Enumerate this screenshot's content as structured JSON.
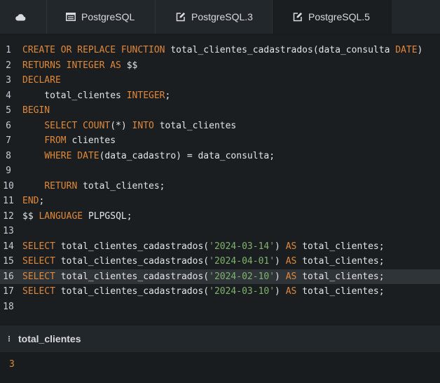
{
  "tabs": {
    "home_icon": "cloud-icon",
    "items": [
      {
        "label": "PostgreSQL",
        "icon": "table-icon",
        "active": false
      },
      {
        "label": "PostgreSQL.3",
        "icon": "edit-icon",
        "active": false
      },
      {
        "label": "PostgreSQL.5",
        "icon": "edit-icon",
        "active": true
      }
    ]
  },
  "editor": {
    "highlighted_line": 16,
    "lines": [
      [
        [
          "kw",
          "CREATE OR REPLACE FUNCTION "
        ],
        [
          "t",
          "total_clientes_cadastrados(data_consulta "
        ],
        [
          "kw",
          "DATE"
        ],
        [
          "t",
          ")"
        ]
      ],
      [
        [
          "kw",
          "RETURNS INTEGER AS "
        ],
        [
          "t",
          "$$"
        ]
      ],
      [
        [
          "kw",
          "DECLARE"
        ]
      ],
      [
        [
          "t",
          "    total_clientes "
        ],
        [
          "kw",
          "INTEGER"
        ],
        [
          "t",
          ";"
        ]
      ],
      [
        [
          "kw",
          "BEGIN"
        ]
      ],
      [
        [
          "t",
          "    "
        ],
        [
          "kw",
          "SELECT COUNT"
        ],
        [
          "t",
          "(*) "
        ],
        [
          "kw",
          "INTO "
        ],
        [
          "t",
          "total_clientes"
        ]
      ],
      [
        [
          "t",
          "    "
        ],
        [
          "kw",
          "FROM "
        ],
        [
          "t",
          "clientes"
        ]
      ],
      [
        [
          "t",
          "    "
        ],
        [
          "kw",
          "WHERE DATE"
        ],
        [
          "t",
          "(data_cadastro) = data_consulta;"
        ]
      ],
      [],
      [
        [
          "t",
          "    "
        ],
        [
          "kw",
          "RETURN "
        ],
        [
          "t",
          "total_clientes;"
        ]
      ],
      [
        [
          "kw",
          "END"
        ],
        [
          "t",
          ";"
        ]
      ],
      [
        [
          "t",
          "$$ "
        ],
        [
          "kw",
          "LANGUAGE "
        ],
        [
          "t",
          "PLPGSQL;"
        ]
      ],
      [],
      [
        [
          "kw",
          "SELECT "
        ],
        [
          "t",
          "total_clientes_cadastrados("
        ],
        [
          "str",
          "'2024-03-14'"
        ],
        [
          "t",
          ") "
        ],
        [
          "kw",
          "AS "
        ],
        [
          "t",
          "total_clientes;"
        ]
      ],
      [
        [
          "kw",
          "SELECT "
        ],
        [
          "t",
          "total_clientes_cadastrados("
        ],
        [
          "str",
          "'2024-04-01'"
        ],
        [
          "t",
          ") "
        ],
        [
          "kw",
          "AS "
        ],
        [
          "t",
          "total_clientes;"
        ]
      ],
      [
        [
          "kw",
          "SELECT "
        ],
        [
          "t",
          "total_clientes_cadastrados("
        ],
        [
          "str",
          "'2024-02-10'"
        ],
        [
          "t",
          ") "
        ],
        [
          "kw",
          "AS "
        ],
        [
          "t",
          "total_clientes;"
        ]
      ],
      [
        [
          "kw",
          "SELECT "
        ],
        [
          "t",
          "total_clientes_cadastrados("
        ],
        [
          "str",
          "'2024-03-10'"
        ],
        [
          "t",
          ") "
        ],
        [
          "kw",
          "AS "
        ],
        [
          "t",
          "total_clientes;"
        ]
      ],
      []
    ]
  },
  "results": {
    "column_grip": "⁝",
    "column": "total_clientes",
    "rows": [
      "3"
    ]
  },
  "colors": {
    "keyword": "#e0883a",
    "string": "#7fb36d",
    "text": "#e3e5e8",
    "background": "#1a1e21"
  }
}
